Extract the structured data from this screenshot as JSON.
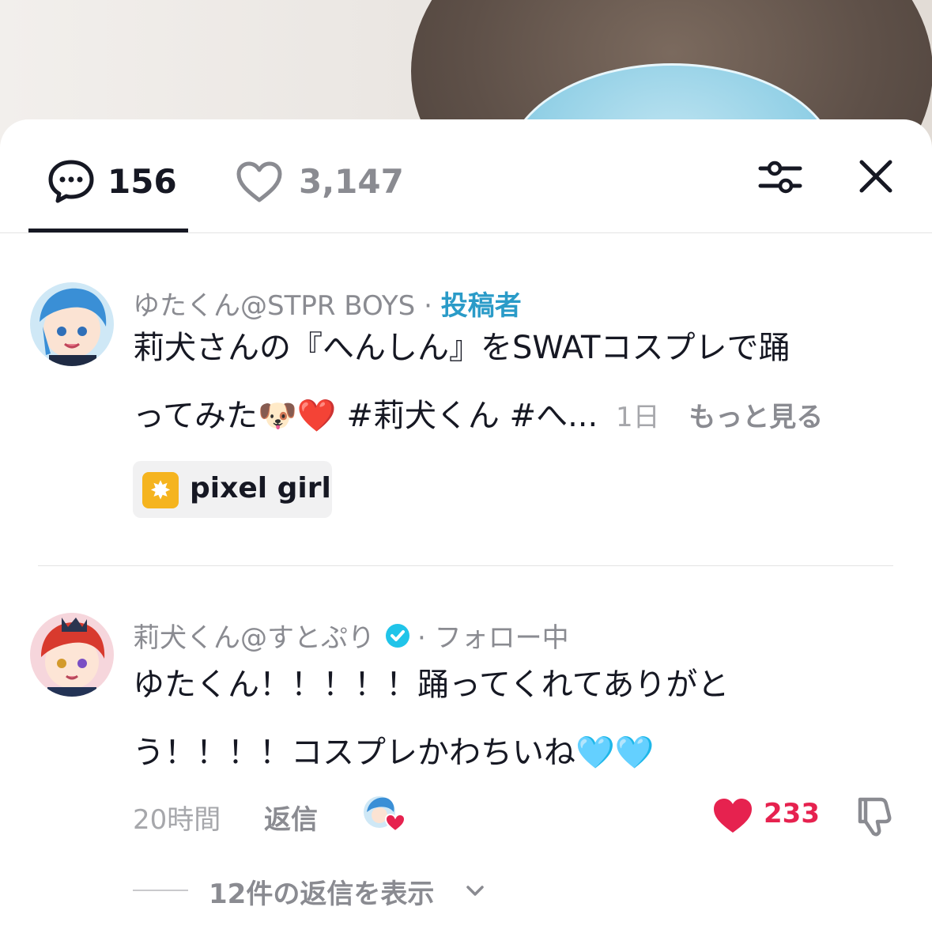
{
  "header": {
    "comment_count": "156",
    "like_count": "3,147"
  },
  "post": {
    "author": "ゆたくん@STPR BOYS",
    "separator": "·",
    "creator_label": "投稿者",
    "caption_line1": "莉犬さんの『へんしん』をSWATコスプレで踊",
    "caption_line2": "ってみた🐶❤️ #莉犬くん #へ...",
    "time": "1日",
    "see_more": "もっと見る",
    "tag": "pixel girl"
  },
  "comment": {
    "author": "莉犬くん@すとぷり",
    "status": "· フォロー中",
    "text_line1": "ゆたくん！！！！！踊ってくれてありがと",
    "text_line2": "う！！！！コスプレかわちいね🩵🩵",
    "time": "20時間",
    "reply_label": "返信",
    "like_count": "233",
    "view_replies": "12件の返信を表示"
  },
  "colors": {
    "accent_red": "#e6224f",
    "creator_blue": "#2a9bc8",
    "verified": "#20c4e9",
    "text_primary": "#161823",
    "text_secondary": "#8a8b91"
  },
  "icons": [
    "comment-bubble-icon",
    "heart-outline-icon",
    "filter-sliders-icon",
    "close-icon",
    "verified-check-icon",
    "heart-filled-icon",
    "thumbs-down-icon",
    "chevron-down-icon"
  ]
}
